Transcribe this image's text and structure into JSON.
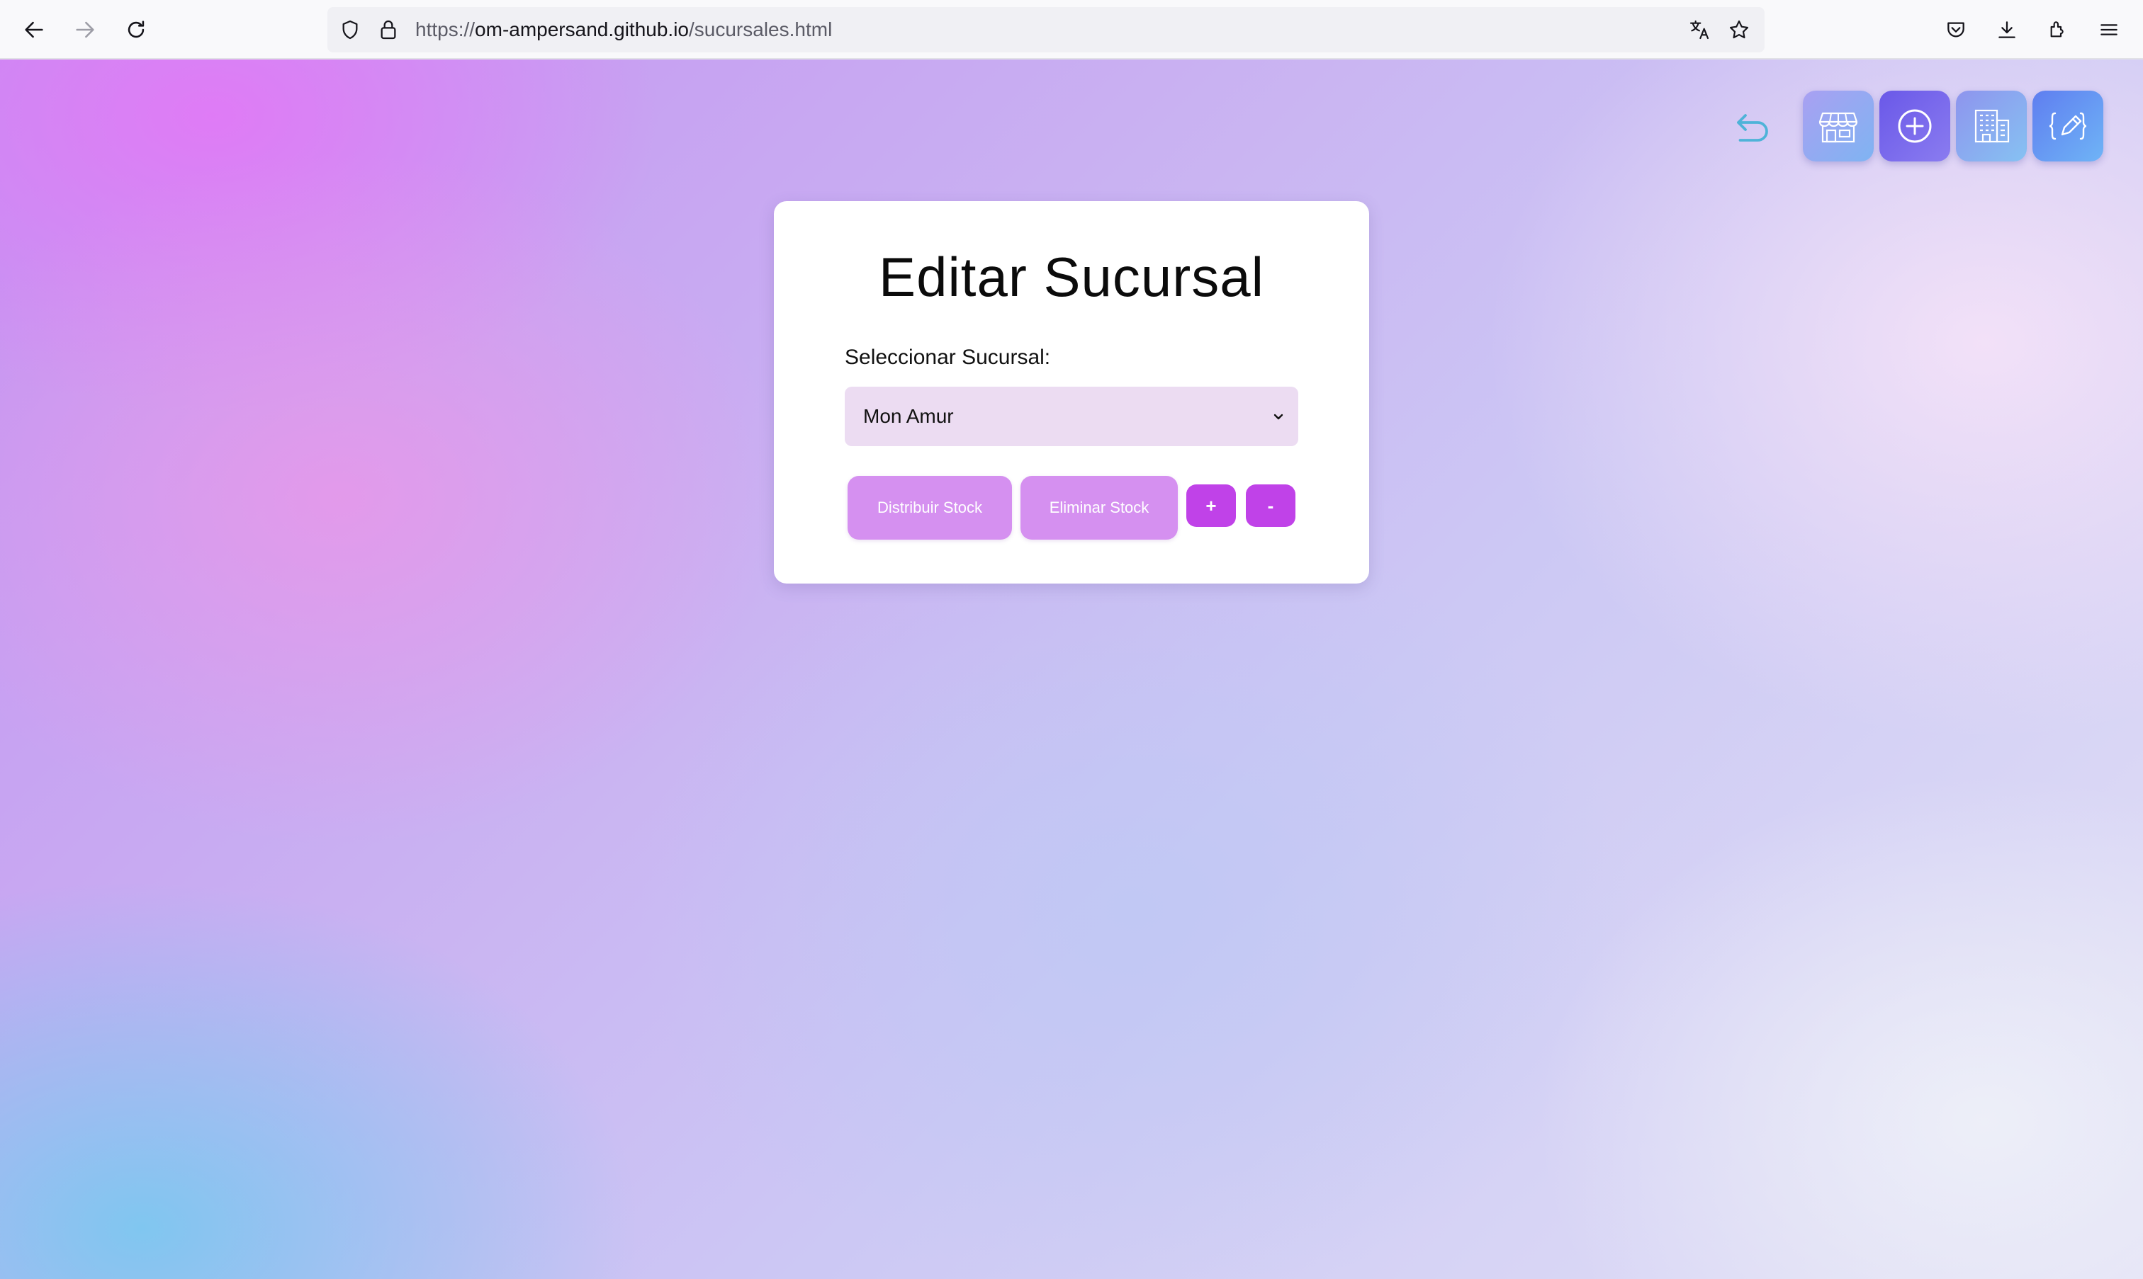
{
  "browser": {
    "url_prefix": "https://",
    "url_host": "om-ampersand.github.io",
    "url_path": "/sucursales.html"
  },
  "toolbar_icons": [
    "undo-icon",
    "store-icon",
    "add-circle-icon",
    "building-icon",
    "edit-code-icon"
  ],
  "card": {
    "title": "Editar Sucursal",
    "select_label": "Seleccionar Sucursal:",
    "selected_branch": "Mon Amur",
    "buttons": {
      "distribute": "Distribuir Stock",
      "delete": "Eliminar Stock",
      "plus": "+",
      "minus": "-"
    }
  },
  "colors": {
    "soft_button": "#d590f0",
    "strong_button": "#c042e8",
    "select_background": "#ecdcf2",
    "undo_icon": "#4fb3d8"
  }
}
